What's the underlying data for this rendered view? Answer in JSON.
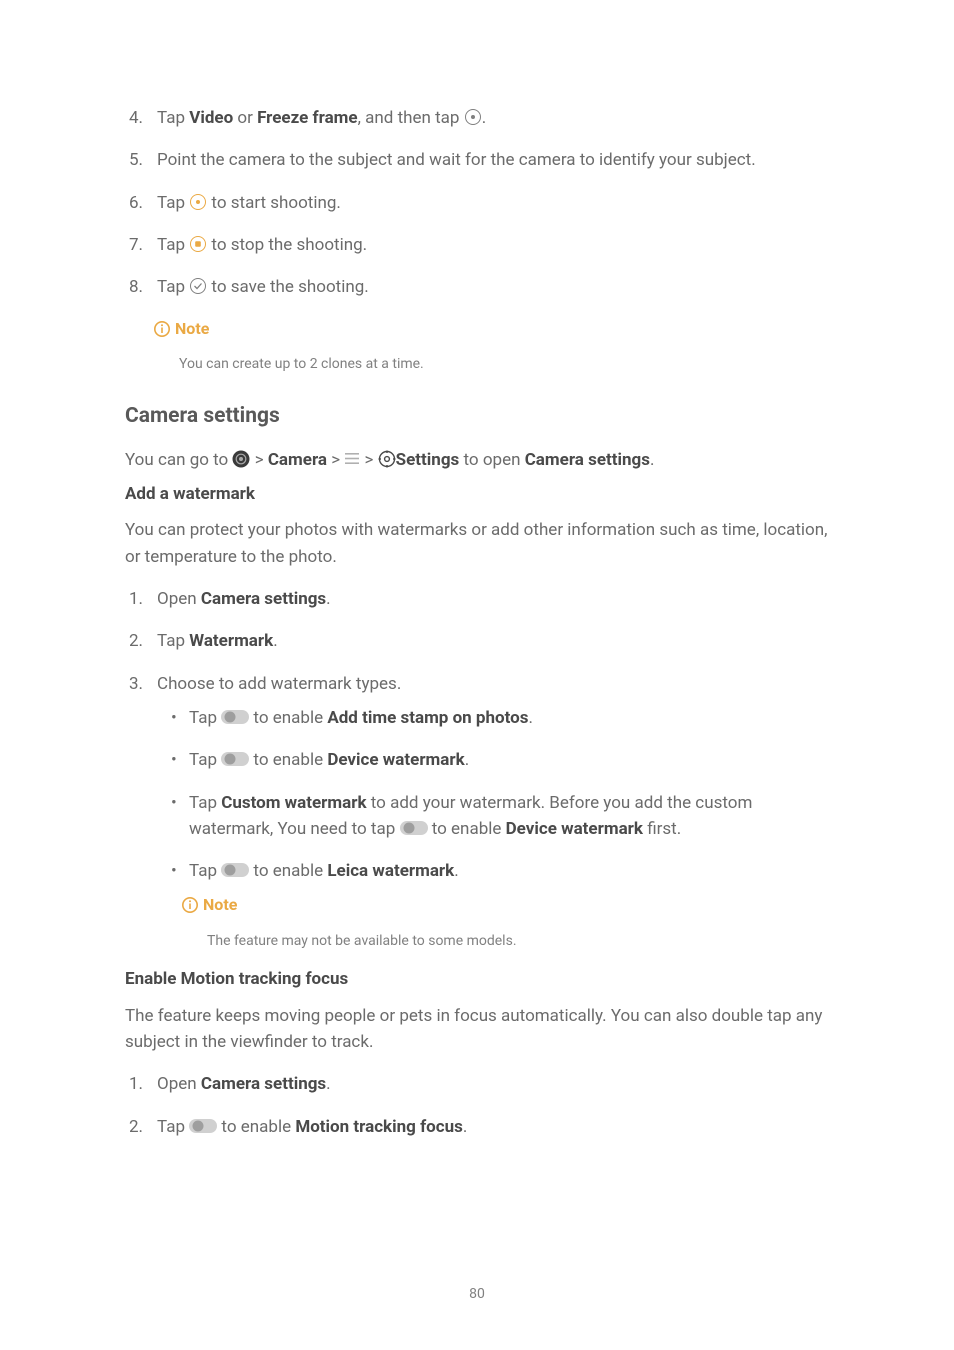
{
  "steps_top": {
    "s4_a": "Tap ",
    "s4_b1": "Video",
    "s4_or": " or ",
    "s4_b2": "Freeze frame",
    "s4_c": ", and then tap ",
    "s4_d": ".",
    "s5": "Point the camera to the subject and wait for the camera to identify your subject.",
    "s6_a": "Tap ",
    "s6_b": " to start shooting.",
    "s7_a": "Tap ",
    "s7_b": " to stop the shooting.",
    "s8_a": "Tap ",
    "s8_b": " to save the shooting."
  },
  "number": {
    "n1": "1.",
    "n2": "2.",
    "n3": "3.",
    "n4": "4.",
    "n5": "5.",
    "n6": "6.",
    "n7": "7.",
    "n8": "8."
  },
  "note_label": "Note",
  "note_top": "You can create up to 2 clones at a time.",
  "h2_camera_settings": "Camera settings",
  "path": {
    "pre": "You can go to ",
    "camera": "Camera",
    "sep": " > ",
    "settings": "Settings",
    "open": " to open ",
    "camera_settings": "Camera settings",
    "period": "."
  },
  "h3_watermark": "Add a watermark",
  "watermark_intro": "You can protect your photos with watermarks or add other information such as time, location, or temperature to the photo.",
  "wm_steps": {
    "s1_a": "Open ",
    "s1_b": "Camera settings",
    "s1_c": ".",
    "s2_a": "Tap ",
    "s2_b": "Watermark",
    "s2_c": ".",
    "s3": "Choose to add watermark types."
  },
  "wm_bullets": {
    "b1_a": "Tap ",
    "b1_b": " to enable ",
    "b1_c": "Add time stamp on photos",
    "b1_d": ".",
    "b2_a": "Tap ",
    "b2_b": " to enable ",
    "b2_c": "Device watermark",
    "b2_d": ".",
    "b3_a": "Tap ",
    "b3_b": "Custom watermark",
    "b3_c": " to add your watermark. Before you add the custom watermark, You need to tap ",
    "b3_d": " to enable ",
    "b3_e": "Device watermark",
    "b3_f": " first.",
    "b4_a": "Tap ",
    "b4_b": " to enable ",
    "b4_c": "Leica watermark",
    "b4_d": "."
  },
  "note_wm": "The feature may not be available to some models.",
  "h3_motion": "Enable Motion tracking focus",
  "motion_intro": "The feature keeps moving people or pets in focus automatically. You can also double tap any subject in the viewfinder to track.",
  "motion_steps": {
    "s1_a": "Open ",
    "s1_b": "Camera settings",
    "s1_c": ".",
    "s2_a": "Tap ",
    "s2_b": " to enable ",
    "s2_c": "Motion tracking focus",
    "s2_d": "."
  },
  "page_number": "80"
}
